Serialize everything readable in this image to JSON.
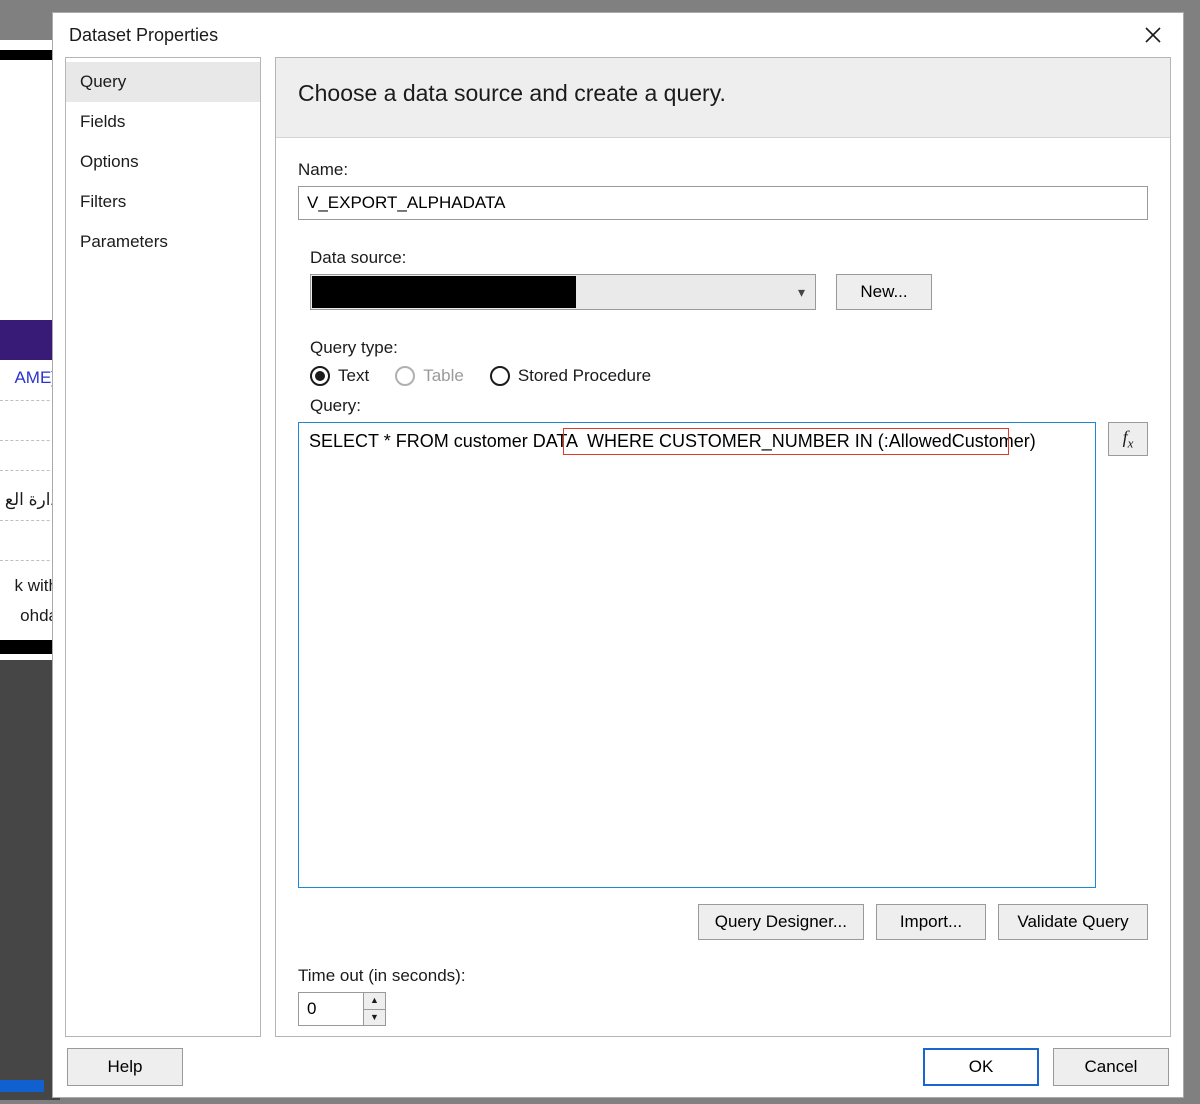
{
  "dialog": {
    "title": "Dataset Properties"
  },
  "nav": {
    "items": [
      {
        "label": "Query",
        "selected": true
      },
      {
        "label": "Fields"
      },
      {
        "label": "Options"
      },
      {
        "label": "Filters"
      },
      {
        "label": "Parameters"
      }
    ]
  },
  "content": {
    "heading": "Choose a data source and create a query.",
    "name_label": "Name:",
    "name_value": "V_EXPORT_ALPHADATA",
    "datasource_label": "Data source:",
    "new_button": "New...",
    "querytype_label": "Query type:",
    "querytype_options": {
      "text": "Text",
      "table": "Table",
      "stored": "Stored Procedure"
    },
    "query_label": "Query:",
    "query_text": "SELECT * FROM customer DATA  WHERE CUSTOMER_NUMBER IN (:AllowedCustomer)",
    "fx_label": "fx",
    "buttons": {
      "designer": "Query Designer...",
      "import": "Import...",
      "validate": "Validate Query"
    },
    "timeout_label": "Time out (in seconds):",
    "timeout_value": "0"
  },
  "footer": {
    "help": "Help",
    "ok": "OK",
    "cancel": "Cancel"
  },
  "bg": {
    "ame": "AME]",
    "ar1": "دارة الع",
    "kwith": "k with",
    "ohda": "ohda"
  }
}
